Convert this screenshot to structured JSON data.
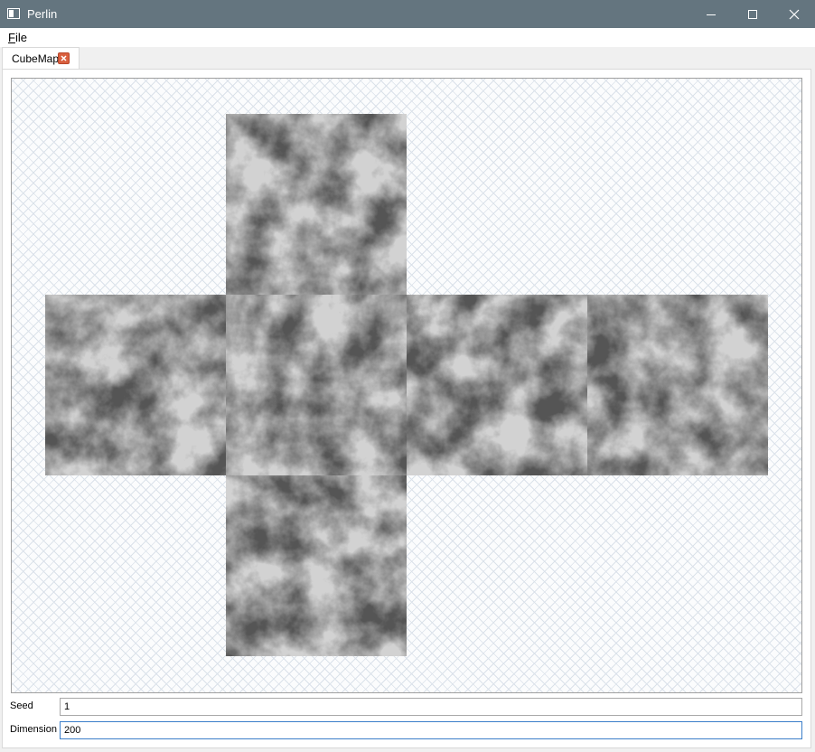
{
  "window": {
    "title": "Perlin",
    "icon": "app-window-icon"
  },
  "menu": {
    "file_prefix": "F",
    "file_rest": "ile"
  },
  "tabs": [
    {
      "label": "CubeMap",
      "close_icon": "close-tab-icon",
      "close_color": "#d9603f"
    }
  ],
  "cubemap": {
    "faces": [
      "top",
      "left",
      "front",
      "right",
      "back",
      "bottom"
    ],
    "noise": "grayscale perlin noise"
  },
  "fields": {
    "seed": {
      "label": "Seed",
      "value": "1"
    },
    "dimension": {
      "label": "Dimension",
      "value": "200"
    }
  },
  "colors": {
    "titlebar": "#64757f",
    "focus_border": "#3b7ec9"
  }
}
